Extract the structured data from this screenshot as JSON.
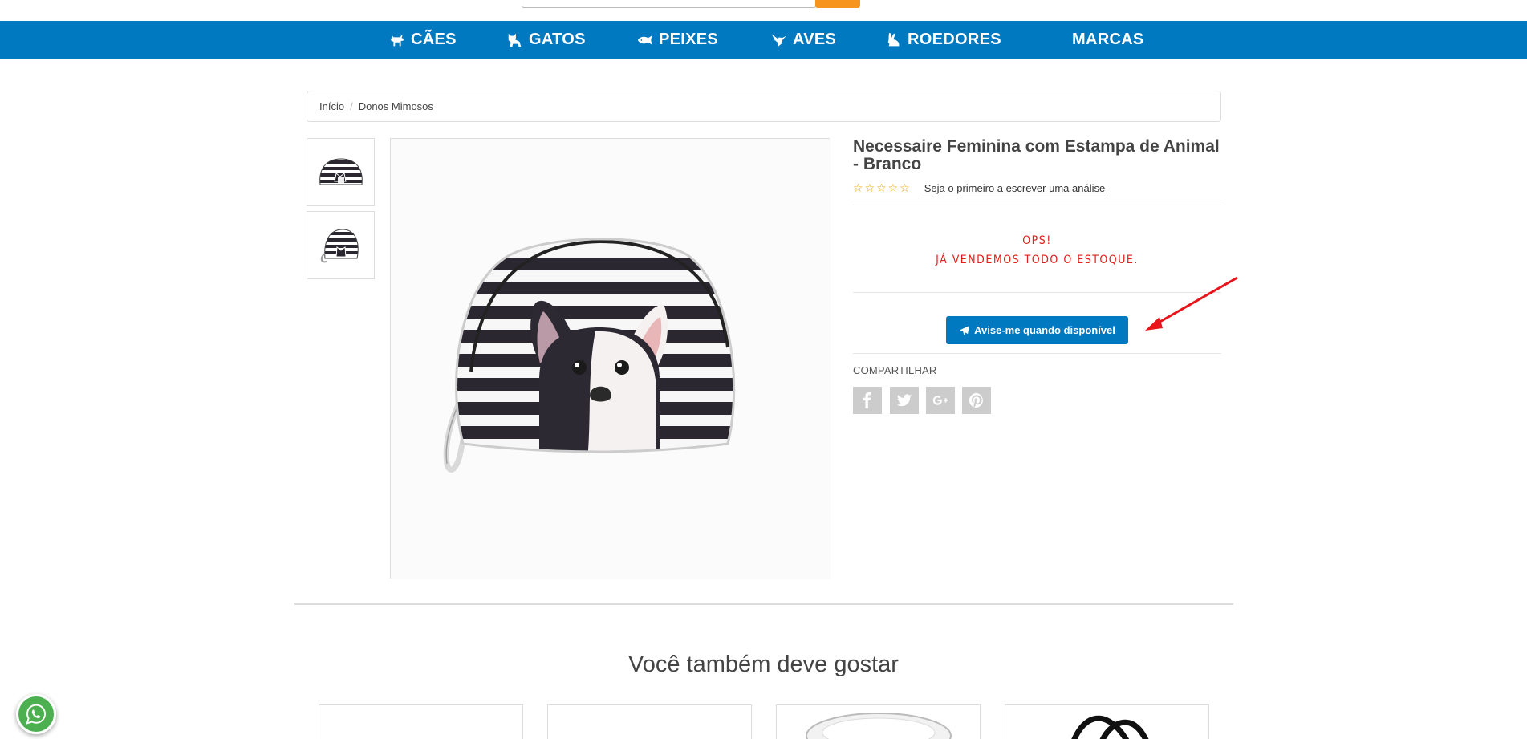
{
  "nav": {
    "items": [
      {
        "label": "CÃES",
        "icon": "dog-icon"
      },
      {
        "label": "GATOS",
        "icon": "cat-icon"
      },
      {
        "label": "PEIXES",
        "icon": "fish-icon"
      },
      {
        "label": "AVES",
        "icon": "bird-icon"
      },
      {
        "label": "ROEDORES",
        "icon": "rabbit-icon"
      },
      {
        "label": "MARCAS",
        "icon": ""
      }
    ]
  },
  "breadcrumb": {
    "home": "Início",
    "separator": "/",
    "current": "Donos Mimosos"
  },
  "product": {
    "title": "Necessaire Feminina com Estampa de Animal - Branco",
    "stars": "☆☆☆☆☆",
    "review_link": "Seja o primeiro a escrever uma análise",
    "out_of_stock_line1": "OPS!",
    "out_of_stock_line2": "JÁ VENDEMOS TODO O ESTOQUE.",
    "notify_button": "Avise-me quando disponível"
  },
  "share": {
    "label": "COMPARTILHAR",
    "networks": [
      "facebook-icon",
      "twitter-icon",
      "google-plus-icon",
      "pinterest-icon"
    ]
  },
  "related": {
    "heading": "Você também deve gostar"
  },
  "colors": {
    "brand_blue": "#0079c1",
    "out_of_stock_red": "#e0201b",
    "search_orange": "#f7941d",
    "whatsapp_green": "#4caf50"
  }
}
